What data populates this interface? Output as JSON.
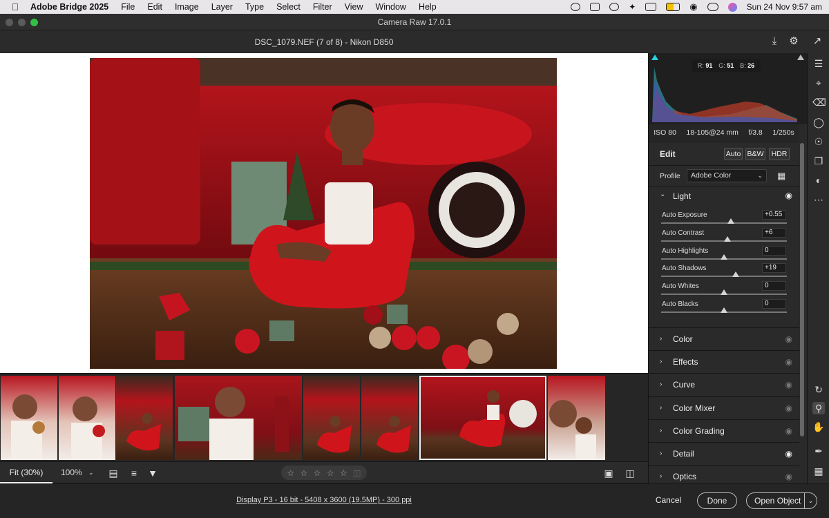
{
  "menubar": {
    "app": "Adobe Bridge 2025",
    "items": [
      "File",
      "Edit",
      "Image",
      "Layer",
      "Type",
      "Select",
      "Filter",
      "View",
      "Window",
      "Help"
    ],
    "datetime": "Sun 24 Nov  9:57 am"
  },
  "window": {
    "title": "Camera Raw 17.0.1"
  },
  "header": {
    "file_title": "DSC_1079.NEF (7 of 8)  -  Nikon D850"
  },
  "histogram": {
    "r_label": "R:",
    "r": "91",
    "g_label": "G:",
    "g": "51",
    "b_label": "B:",
    "b": "26"
  },
  "exif": {
    "iso": "ISO 80",
    "lens": "18-105@24 mm",
    "aperture": "f/3.8",
    "shutter": "1/250s"
  },
  "edit": {
    "title": "Edit",
    "auto_label": "Auto",
    "bw_label": "B&W",
    "hdr_label": "HDR",
    "profile_label": "Profile",
    "profile_value": "Adobe Color"
  },
  "light": {
    "title": "Light",
    "sliders": [
      {
        "label": "Auto Exposure",
        "value": "+0.55",
        "level": 0.555
      },
      {
        "label": "Auto Contrast",
        "value": "+6",
        "level": 0.53
      },
      {
        "label": "Auto Highlights",
        "value": "0",
        "level": 0.5
      },
      {
        "label": "Auto Shadows",
        "value": "+19",
        "level": 0.595
      },
      {
        "label": "Auto Whites",
        "value": "0",
        "level": 0.5
      },
      {
        "label": "Auto Blacks",
        "value": "0",
        "level": 0.5
      }
    ]
  },
  "sections": [
    "Color",
    "Effects",
    "Curve",
    "Color Mixer",
    "Color Grading",
    "Detail",
    "Optics"
  ],
  "toolbar": {
    "zoom_fit": "Fit (30%)",
    "zoom_100": "100%"
  },
  "footer": {
    "info": "Display P3 - 16 bit - 5408 x 3600 (19.5MP) - 300 ppi",
    "cancel": "Cancel",
    "done": "Done",
    "open": "Open Object"
  },
  "colors": {
    "accent_red": "#c9141c",
    "panel_bg": "#2a2a2a",
    "canvas_bg": "#ffffff"
  }
}
